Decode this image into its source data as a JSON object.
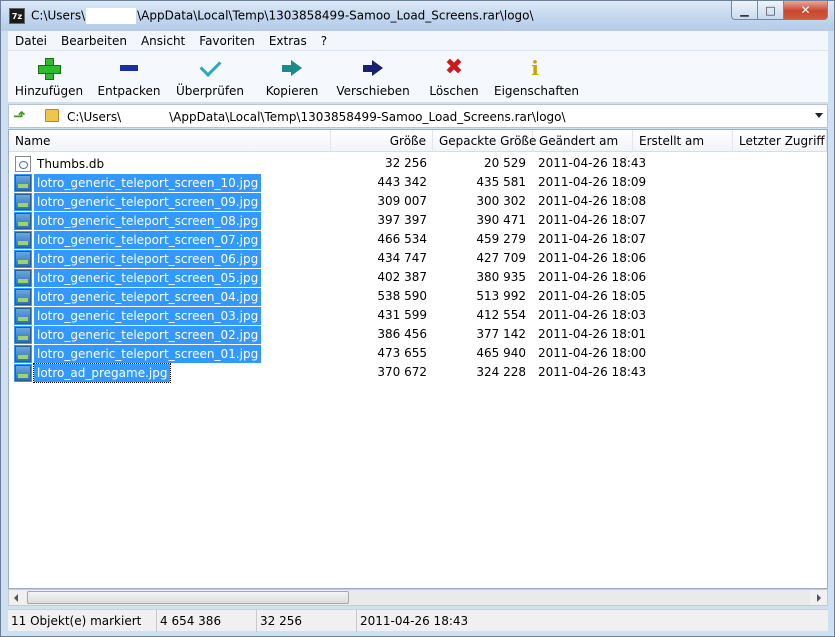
{
  "window": {
    "title_prefix": "C:\\Users\\",
    "title_suffix": "\\AppData\\Local\\Temp\\1303858499-Samoo_Load_Screens.rar\\logo\\",
    "app_icon": "7z"
  },
  "menu": [
    "Datei",
    "Bearbeiten",
    "Ansicht",
    "Favoriten",
    "Extras",
    "?"
  ],
  "toolbar": {
    "add": "Hinzufügen",
    "extract": "Entpacken",
    "test": "Überprüfen",
    "copy": "Kopieren",
    "move": "Verschieben",
    "delete": "Löschen",
    "info": "Eigenschaften"
  },
  "address": {
    "prefix": "C:\\Users\\",
    "suffix": "\\AppData\\Local\\Temp\\1303858499-Samoo_Load_Screens.rar\\logo\\"
  },
  "columns": {
    "name": "Name",
    "size": "Größe",
    "packed": "Gepackte Größe",
    "modified": "Geändert am",
    "created": "Erstellt am",
    "accessed": "Letzter Zugriff"
  },
  "files": [
    {
      "name": "Thumbs.db",
      "size": "32 256",
      "packed": "20 529",
      "modified": "2011-04-26 18:43",
      "type": "db",
      "selected": false
    },
    {
      "name": "lotro_generic_teleport_screen_10.jpg",
      "size": "443 342",
      "packed": "435 581",
      "modified": "2011-04-26 18:09",
      "type": "jpg",
      "selected": true
    },
    {
      "name": "lotro_generic_teleport_screen_09.jpg",
      "size": "309 007",
      "packed": "300 302",
      "modified": "2011-04-26 18:08",
      "type": "jpg",
      "selected": true
    },
    {
      "name": "lotro_generic_teleport_screen_08.jpg",
      "size": "397 397",
      "packed": "390 471",
      "modified": "2011-04-26 18:07",
      "type": "jpg",
      "selected": true
    },
    {
      "name": "lotro_generic_teleport_screen_07.jpg",
      "size": "466 534",
      "packed": "459 279",
      "modified": "2011-04-26 18:07",
      "type": "jpg",
      "selected": true
    },
    {
      "name": "lotro_generic_teleport_screen_06.jpg",
      "size": "434 747",
      "packed": "427 709",
      "modified": "2011-04-26 18:06",
      "type": "jpg",
      "selected": true
    },
    {
      "name": "lotro_generic_teleport_screen_05.jpg",
      "size": "402 387",
      "packed": "380 935",
      "modified": "2011-04-26 18:06",
      "type": "jpg",
      "selected": true
    },
    {
      "name": "lotro_generic_teleport_screen_04.jpg",
      "size": "538 590",
      "packed": "513 992",
      "modified": "2011-04-26 18:05",
      "type": "jpg",
      "selected": true
    },
    {
      "name": "lotro_generic_teleport_screen_03.jpg",
      "size": "431 599",
      "packed": "412 554",
      "modified": "2011-04-26 18:03",
      "type": "jpg",
      "selected": true
    },
    {
      "name": "lotro_generic_teleport_screen_02.jpg",
      "size": "386 456",
      "packed": "377 142",
      "modified": "2011-04-26 18:01",
      "type": "jpg",
      "selected": true
    },
    {
      "name": "lotro_generic_teleport_screen_01.jpg",
      "size": "473 655",
      "packed": "465 940",
      "modified": "2011-04-26 18:00",
      "type": "jpg",
      "selected": true
    },
    {
      "name": "lotro_ad_pregame.jpg",
      "size": "370 672",
      "packed": "324 228",
      "modified": "2011-04-26 18:43",
      "type": "jpg",
      "selected": true,
      "focused": true
    }
  ],
  "status": {
    "selected": "11 Objekt(e) markiert",
    "total_size": "4 654 386",
    "item_size": "32 256",
    "item_date": "2011-04-26 18:43"
  },
  "colors": {
    "selection": "#3399ff",
    "selection_text": "#ffffff"
  }
}
